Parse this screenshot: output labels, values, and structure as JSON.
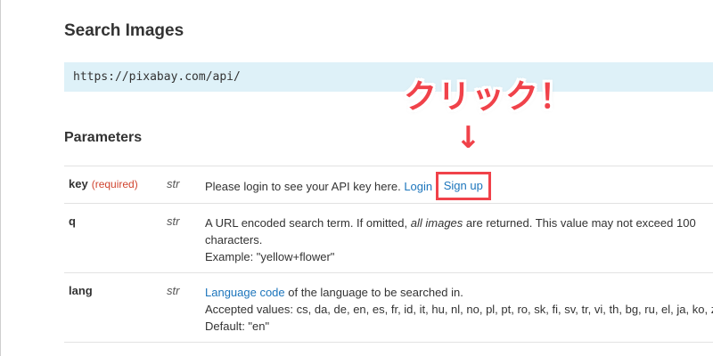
{
  "section": {
    "title": "Search Images",
    "endpoint": "https://pixabay.com/api/"
  },
  "parameters": {
    "title": "Parameters",
    "rows": [
      {
        "name": "key",
        "required": "(required)",
        "type": "str",
        "desc_prefix": "Please login to see your API key here.",
        "login_link": "Login",
        "signup_link": "Sign up"
      },
      {
        "name": "q",
        "type": "str",
        "desc_a": "A URL encoded search term. If omitted,",
        "desc_em": "all images",
        "desc_b": "are returned. This value may not exceed 100 characters.",
        "example": "Example: \"yellow+flower\""
      },
      {
        "name": "lang",
        "type": "str",
        "link_text": "Language code",
        "desc_after_link": "of the language to be searched in.",
        "accepted": "Accepted values: cs, da, de, en, es, fr, id, it, hu, nl, no, pl, pt, ro, sk, fi, sv, tr, vi, th, bg, ru, el, ja, ko, zh",
        "default": "Default: \"en\""
      }
    ]
  },
  "annotation": {
    "text": "クリック！",
    "arrow": "↓",
    "color": "#f0424a"
  },
  "colors": {
    "link": "#1c75bc",
    "required": "#d0442f",
    "code_bg": "#def1f8"
  }
}
